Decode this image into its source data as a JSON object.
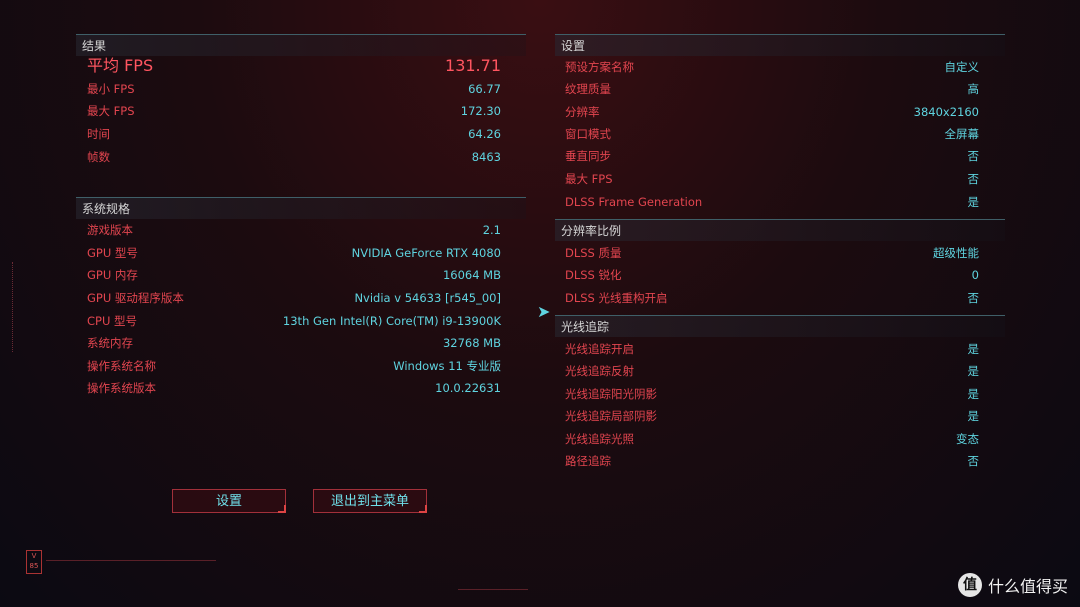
{
  "results": {
    "title": "结果",
    "avg_fps": {
      "label": "平均 FPS",
      "value": "131.71"
    },
    "rows": [
      {
        "label": "最小 FPS",
        "value": "66.77"
      },
      {
        "label": "最大 FPS",
        "value": "172.30"
      },
      {
        "label": "时间",
        "value": "64.26"
      },
      {
        "label": "帧数",
        "value": "8463"
      }
    ]
  },
  "system": {
    "title": "系统规格",
    "rows": [
      {
        "label": "游戏版本",
        "value": "2.1"
      },
      {
        "label": "GPU 型号",
        "value": "NVIDIA GeForce RTX 4080"
      },
      {
        "label": "GPU 内存",
        "value": "16064 MB"
      },
      {
        "label": "GPU 驱动程序版本",
        "value": "Nvidia v 54633 [r545_00]"
      },
      {
        "label": "CPU 型号",
        "value": "13th Gen Intel(R) Core(TM) i9-13900K"
      },
      {
        "label": "系统内存",
        "value": "32768 MB"
      },
      {
        "label": "操作系统名称",
        "value": "Windows 11 专业版"
      },
      {
        "label": "操作系统版本",
        "value": "10.0.22631"
      }
    ]
  },
  "settings": {
    "title": "设置",
    "rows": [
      {
        "label": "预设方案名称",
        "value": "自定义"
      },
      {
        "label": "纹理质量",
        "value": "高"
      },
      {
        "label": "分辨率",
        "value": "3840x2160"
      },
      {
        "label": "窗口模式",
        "value": "全屏幕"
      },
      {
        "label": "垂直同步",
        "value": "否"
      },
      {
        "label": "最大 FPS",
        "value": "否"
      },
      {
        "label": "DLSS Frame Generation",
        "value": "是"
      }
    ]
  },
  "scale": {
    "title": "分辨率比例",
    "rows": [
      {
        "label": "DLSS 质量",
        "value": "超级性能"
      },
      {
        "label": "DLSS 锐化",
        "value": "0"
      },
      {
        "label": "DLSS 光线重构开启",
        "value": "否"
      }
    ]
  },
  "raytracing": {
    "title": "光线追踪",
    "rows": [
      {
        "label": "光线追踪开启",
        "value": "是"
      },
      {
        "label": "光线追踪反射",
        "value": "是"
      },
      {
        "label": "光线追踪阳光阴影",
        "value": "是"
      },
      {
        "label": "光线追踪局部阴影",
        "value": "是"
      },
      {
        "label": "光线追踪光照",
        "value": "变态"
      },
      {
        "label": "路径追踪",
        "value": "否"
      }
    ]
  },
  "buttons": {
    "settings": "设置",
    "exit": "退出到主菜单"
  },
  "badge": "V 85",
  "watermark": {
    "icon": "值",
    "text": "什么值得买"
  },
  "colors": {
    "label": "#e2454f",
    "value": "#5fd4e0",
    "accent": "#ff5560"
  }
}
